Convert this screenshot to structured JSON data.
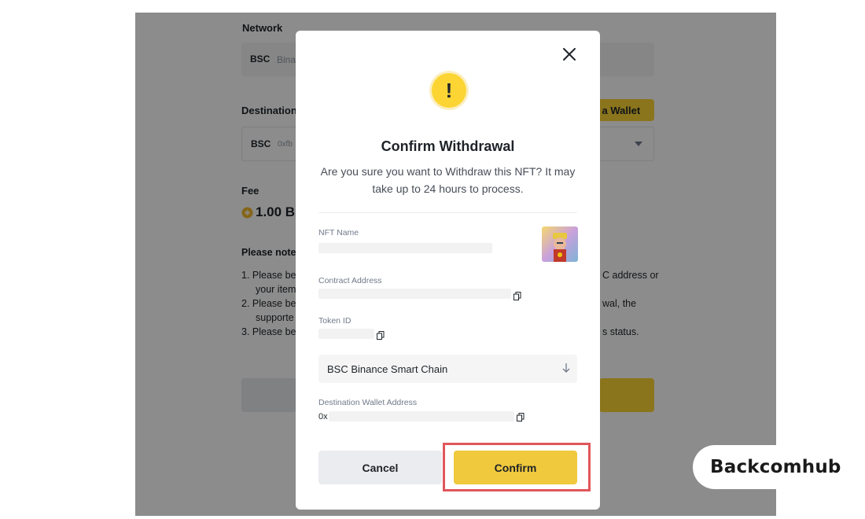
{
  "background": {
    "network_label": "Network",
    "network_code": "BSC",
    "network_name_partial": "Bina",
    "destination_label": "Destination",
    "add_wallet_label": "d a Wallet",
    "dest_code": "BSC",
    "dest_address_partial": "0xfb",
    "fee_label": "Fee",
    "fee_value": "1.00 B",
    "please_note_label": "Please note:",
    "note1_left": "1.  Please be",
    "note1_right": "C address or",
    "note1b_left": "your item",
    "note2_left": "2.  Please be",
    "note2_right": "wal, the",
    "note2b_left": "supporte",
    "note3_left": "3.  Please be",
    "note3_right": "s status."
  },
  "modal": {
    "title": "Confirm Withdrawal",
    "description": "Are you sure you want to Withdraw this NFT? It may take up to 24 hours to process.",
    "nft_name_label": "NFT Name",
    "contract_address_label": "Contract Address",
    "token_id_label": "Token ID",
    "network_select_value": "BSC Binance Smart Chain",
    "destination_wallet_label": "Destination Wallet Address",
    "destination_wallet_prefix": "0x",
    "cancel_label": "Cancel",
    "confirm_label": "Confirm",
    "warning_glyph": "!"
  },
  "icons": {
    "close": "close-icon",
    "warning": "warning-icon",
    "copy": "copy-icon",
    "arrow": "arrow-down-icon",
    "coin": "bnb-coin-icon"
  },
  "colors": {
    "accent_yellow": "#fcd535",
    "confirm_button": "#f0c93c",
    "highlight_red": "#e0565b"
  },
  "watermark": {
    "brand_text": "Backcomhub"
  }
}
